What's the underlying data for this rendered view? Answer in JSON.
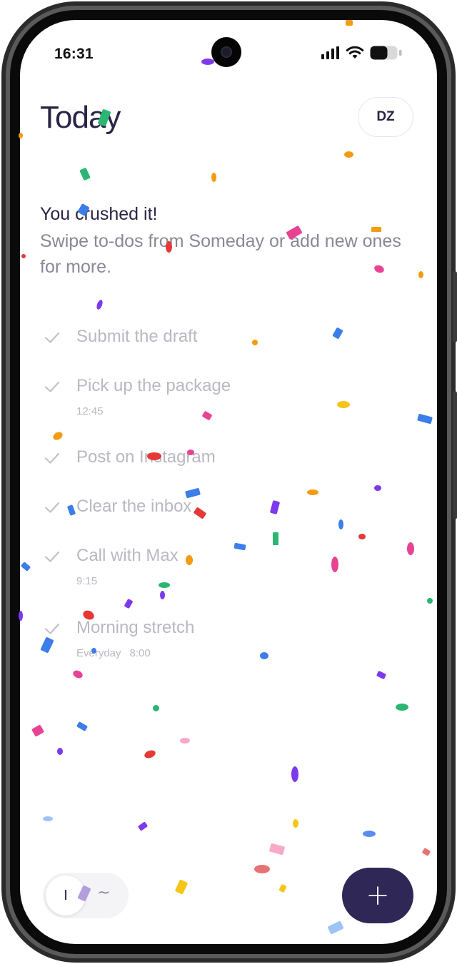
{
  "status_bar": {
    "time": "16:31",
    "icons": [
      "cellular-signal-icon",
      "wifi-icon",
      "battery-icon"
    ]
  },
  "header": {
    "title": "Today",
    "avatar_initials": "DZ"
  },
  "message": {
    "headline": "You crushed it!",
    "body": "Swipe to-dos from Someday or add new ones for more."
  },
  "tasks": [
    {
      "label": "Submit the draft",
      "completed": true
    },
    {
      "label": "Pick up the package",
      "time": "12:45",
      "completed": true
    },
    {
      "label": "Post on Instagram",
      "completed": true
    },
    {
      "label": "Clear the inbox",
      "completed": true
    },
    {
      "label": "Call with Max",
      "time": "9:15",
      "completed": true
    },
    {
      "label": "Morning stretch",
      "repeat": "Everyday",
      "time": "8:00",
      "completed": true
    }
  ],
  "bottom_bar": {
    "toggle_selected_glyph": "I",
    "toggle_other_glyph": "~",
    "add_button_glyph": "+"
  },
  "colors": {
    "primary": "#2f2856",
    "title_text": "#2a2546",
    "muted_text": "#8a8896",
    "completed_text": "#b9b8c3",
    "confetti": [
      "#2bb673",
      "#e84393",
      "#f39c12",
      "#3b7de9",
      "#7c3aed",
      "#e53935",
      "#f5c518"
    ]
  }
}
